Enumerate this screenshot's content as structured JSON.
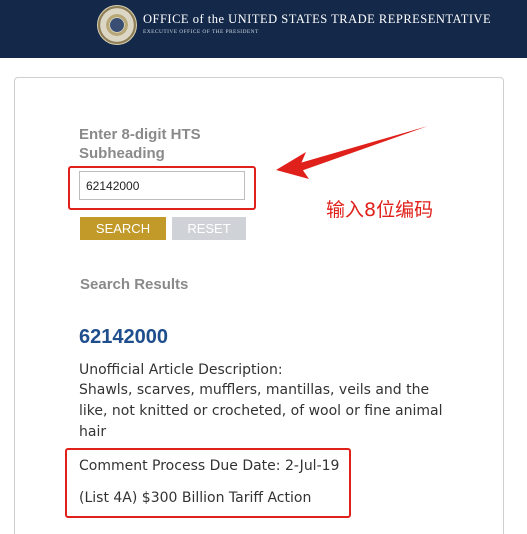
{
  "header": {
    "office_title": "OFFICE of the UNITED STATES TRADE REPRESENTATIVE",
    "office_subtitle": "EXECUTIVE OFFICE OF THE PRESIDENT",
    "brand_color": "#14294a",
    "seal_icon": "ustr-seal-icon"
  },
  "search": {
    "label": "Enter 8-digit HTS Subheading",
    "input_value": "62142000",
    "search_label": "SEARCH",
    "reset_label": "RESET",
    "search_color": "#c19a2a",
    "reset_color": "#cfd3d8"
  },
  "results": {
    "heading": "Search Results",
    "code": "62142000",
    "description_label": "Unofficial Article Description:",
    "description": "Shawls, scarves, mufflers, mantillas, veils and the like, not knitted or crocheted, of wool or fine animal hair",
    "due_date": "Comment Process Due Date: 2-Jul-19",
    "action": "(List 4A) $300 Billion Tariff Action"
  },
  "annotation": {
    "text": "输入8位编码",
    "color": "#e0201a"
  }
}
